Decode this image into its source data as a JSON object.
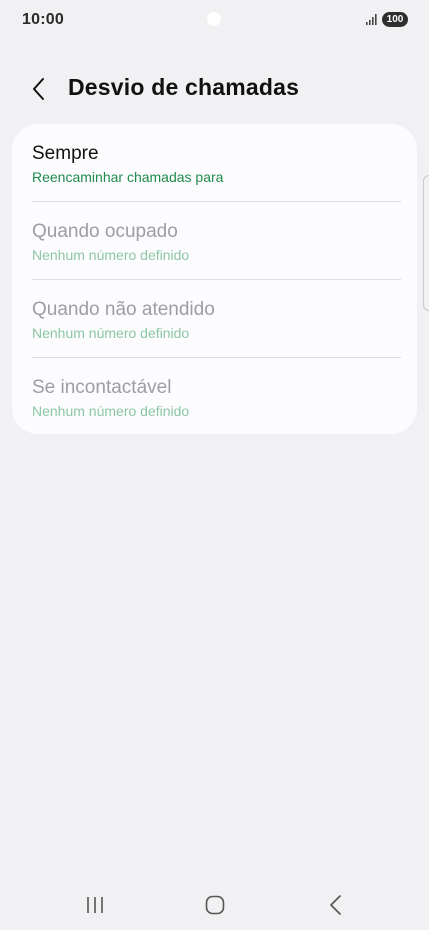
{
  "status_bar": {
    "time": "10:00",
    "battery": "100",
    "signal_icon": "signal-bars-icon"
  },
  "header": {
    "back_icon": "chevron-left-icon",
    "title": "Desvio de chamadas"
  },
  "options": [
    {
      "title": "Sempre",
      "subtitle": "Reencaminhar chamadas para",
      "enabled": true
    },
    {
      "title": "Quando ocupado",
      "subtitle": "Nenhum número definido",
      "enabled": false
    },
    {
      "title": "Quando não atendido",
      "subtitle": "Nenhum número definido",
      "enabled": false
    },
    {
      "title": "Se incontactável",
      "subtitle": "Nenhum número definido",
      "enabled": false
    }
  ],
  "nav_bar": {
    "recents_icon": "recent-apps-icon",
    "home_icon": "home-icon",
    "back_icon": "back-icon"
  },
  "colors": {
    "background": "#f1f1f4",
    "card": "#fcfcfe",
    "accent_green": "#1e8a4c",
    "disabled_green": "#8cc6a4",
    "disabled_text": "#9e9ea2"
  }
}
